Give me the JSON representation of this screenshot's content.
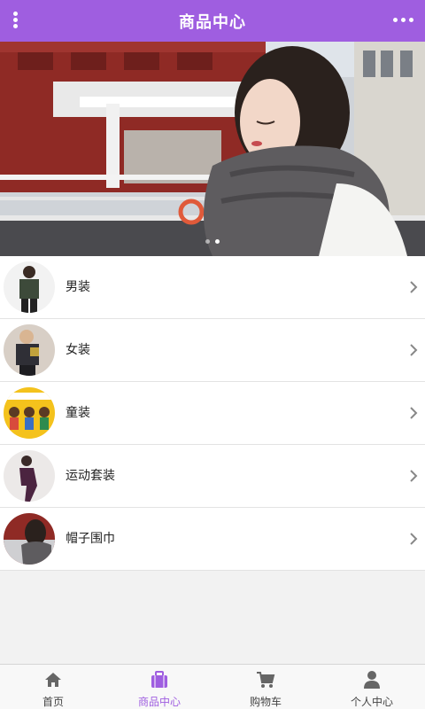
{
  "header": {
    "title": "商品中心",
    "left_icon": "vertical-dots-icon",
    "right_icon": "horizontal-dots-icon"
  },
  "banner": {
    "slide_count": 2,
    "active_index": 1
  },
  "categories": [
    {
      "label": "男装"
    },
    {
      "label": "女装"
    },
    {
      "label": "童装"
    },
    {
      "label": "运动套装"
    },
    {
      "label": "帽子围巾"
    }
  ],
  "tabbar": {
    "active": "商品中心",
    "accent_color": "#9f5ee0",
    "items": [
      {
        "label": "首页",
        "icon": "home-icon"
      },
      {
        "label": "商品中心",
        "icon": "briefcase-icon"
      },
      {
        "label": "购物车",
        "icon": "cart-icon"
      },
      {
        "label": "个人中心",
        "icon": "user-icon"
      }
    ]
  }
}
